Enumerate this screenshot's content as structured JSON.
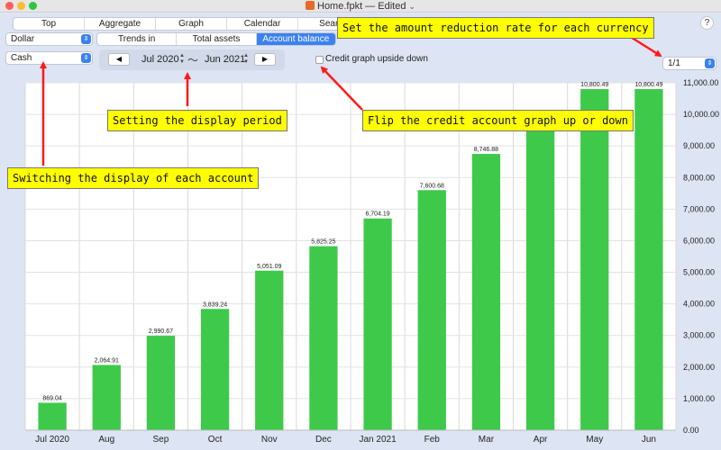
{
  "window": {
    "title": "Home.fpkt — Edited",
    "title_chevron": "⌄"
  },
  "top_tabs": [
    "Top",
    "Aggregate",
    "Graph",
    "Calendar",
    "Search"
  ],
  "currency_select": {
    "value": "Dollar",
    "arrow_icon": "updown-chevron-icon"
  },
  "account_select": {
    "value": "Cash",
    "arrow_icon": "updown-chevron-icon"
  },
  "view_segments": [
    {
      "label": "Trends in expenditure",
      "active": false
    },
    {
      "label": "Total assets",
      "active": false
    },
    {
      "label": "Account balance",
      "active": true
    }
  ],
  "period": {
    "prev_icon": "◀",
    "next_icon": "▶",
    "start": "Jul 2020",
    "separator": "〜",
    "end": "Jun 2021"
  },
  "credit_flip": {
    "label": "Credit graph upside down",
    "checked": false
  },
  "reduction_rate": {
    "value": "1/1"
  },
  "help_button": {
    "label": "?"
  },
  "callouts": {
    "currency_rate": "Set the amount reduction rate for each currency",
    "display_period": "Setting the display period",
    "flip_credit": "Flip the credit account graph up or down",
    "switch_account": "Switching the display of each account"
  },
  "colors": {
    "accent": "#3b82f0",
    "bar": "#3ec94a",
    "callout": "#ffff00",
    "arrow": "#ff1a1a",
    "background": "#dde4f3"
  },
  "chart_data": {
    "type": "bar",
    "categories": [
      "Jul 2020",
      "Aug",
      "Sep",
      "Oct",
      "Nov",
      "Dec",
      "Jan 2021",
      "Feb",
      "Mar",
      "Apr",
      "May",
      "Jun"
    ],
    "values": [
      869.04,
      2064.91,
      2990.67,
      3839.24,
      5051.09,
      5825.25,
      6704.19,
      7600.68,
      8746.88,
      9700,
      10800.49,
      10800.49
    ],
    "value_labels": [
      "869.04",
      "2,064.91",
      "2,990.67",
      "3,839.24",
      "5,051.09",
      "5,825.25",
      "6,704.19",
      "7,600.68",
      "8,746.88",
      "",
      "10,800.49",
      "10,800.49"
    ],
    "y_ticks": [
      "0.00",
      "1,000.00",
      "2,000.00",
      "3,000.00",
      "4,000.00",
      "5,000.00",
      "6,000.00",
      "7,000.00",
      "8,000.00",
      "9,000.00",
      "10,000.00",
      "11,000.00"
    ],
    "ylim": [
      0,
      11000
    ],
    "y_axis_side": "right",
    "grid": true,
    "title": "",
    "xlabel": "",
    "ylabel": ""
  }
}
